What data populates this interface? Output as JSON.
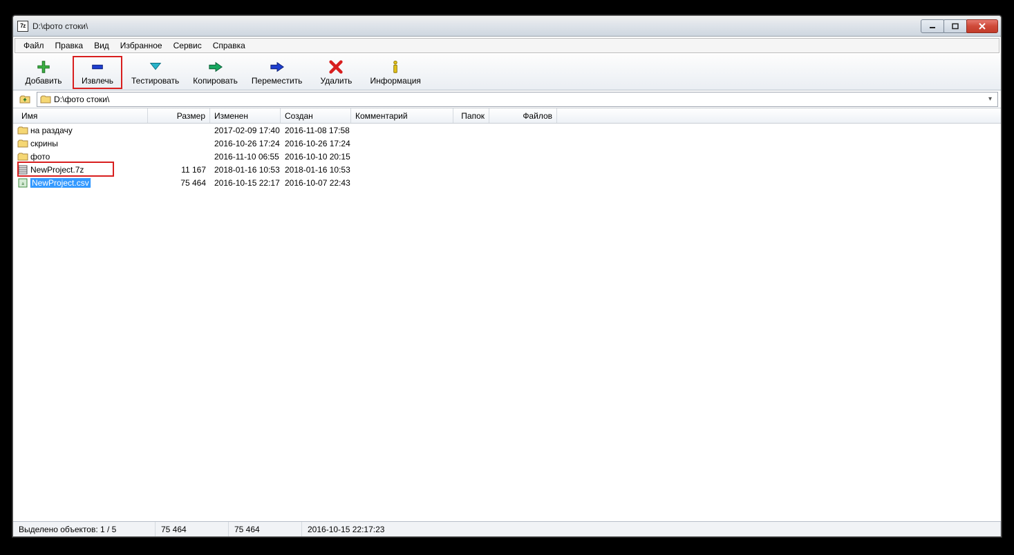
{
  "title": "D:\\фото стоки\\",
  "menu": [
    "Файл",
    "Правка",
    "Вид",
    "Избранное",
    "Сервис",
    "Справка"
  ],
  "toolbar": [
    {
      "name": "add",
      "label": "Добавить"
    },
    {
      "name": "extract",
      "label": "Извлечь",
      "highlight": true
    },
    {
      "name": "test",
      "label": "Тестировать"
    },
    {
      "name": "copy",
      "label": "Копировать"
    },
    {
      "name": "move",
      "label": "Переместить"
    },
    {
      "name": "delete",
      "label": "Удалить"
    },
    {
      "name": "info",
      "label": "Информация"
    }
  ],
  "path": "D:\\фото стоки\\",
  "columns": {
    "name": "Имя",
    "size": "Размер",
    "modified": "Изменен",
    "created": "Создан",
    "comment": "Комментарий",
    "folders": "Папок",
    "files": "Файлов"
  },
  "rows": [
    {
      "icon": "folder",
      "name": "на раздачу",
      "size": "",
      "modified": "2017-02-09 17:40",
      "created": "2016-11-08 17:58"
    },
    {
      "icon": "folder",
      "name": "скрины",
      "size": "",
      "modified": "2016-10-26 17:24",
      "created": "2016-10-26 17:24"
    },
    {
      "icon": "folder",
      "name": "фото",
      "size": "",
      "modified": "2016-11-10 06:55",
      "created": "2016-10-10 20:15"
    },
    {
      "icon": "archive",
      "name": "NewProject.7z",
      "size": "11 167",
      "modified": "2018-01-16 10:53",
      "created": "2018-01-16 10:53",
      "highlight": true
    },
    {
      "icon": "csv",
      "name": "NewProject.csv",
      "size": "75 464",
      "modified": "2016-10-15 22:17",
      "created": "2016-10-07 22:43",
      "selected": true
    }
  ],
  "status": {
    "selection": "Выделено объектов: 1 / 5",
    "size1": "75 464",
    "size2": "75 464",
    "time": "2016-10-15 22:17:23"
  }
}
